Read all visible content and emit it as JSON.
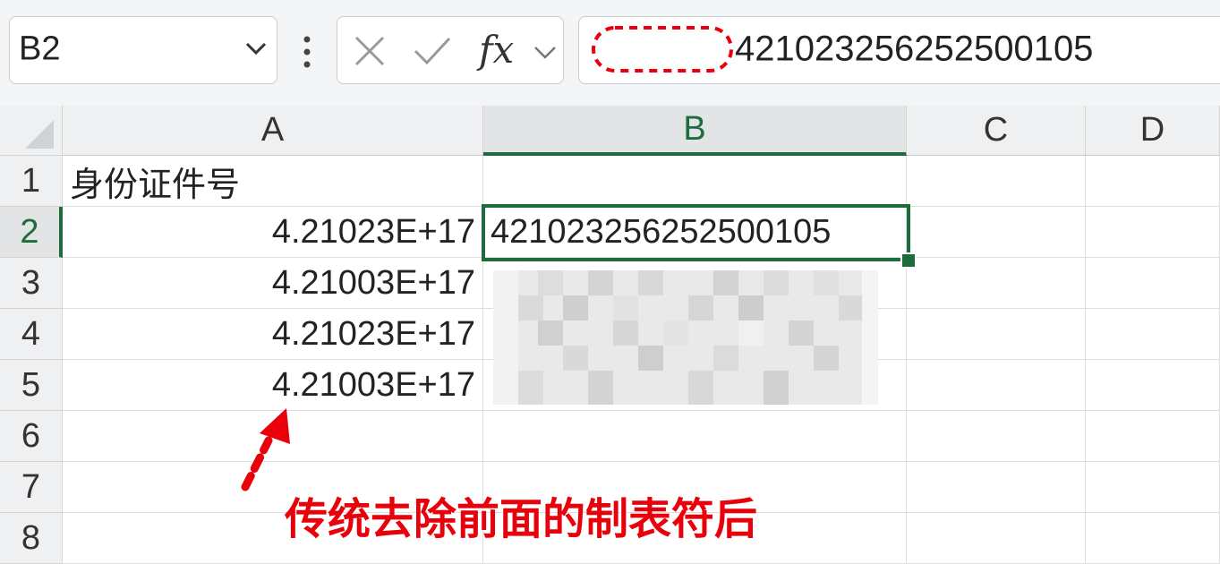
{
  "formula_bar": {
    "name_box": "B2",
    "formula_value": "421023256252500105",
    "fx_label": "fx"
  },
  "columns": [
    "A",
    "B",
    "C",
    "D"
  ],
  "rows": [
    "1",
    "2",
    "3",
    "4",
    "5",
    "6",
    "7",
    "8"
  ],
  "cells": {
    "A1": "身份证件号",
    "A2": "4.21023E+17",
    "A3": "4.21003E+17",
    "A4": "4.21023E+17",
    "A5": "4.21003E+17",
    "B2": "421023256252500105"
  },
  "annotation": {
    "text": "传统去除前面的制表符后",
    "color": "#e8000a"
  },
  "colors": {
    "selection": "#1e6b3c",
    "header_bg": "#eef0f2"
  }
}
